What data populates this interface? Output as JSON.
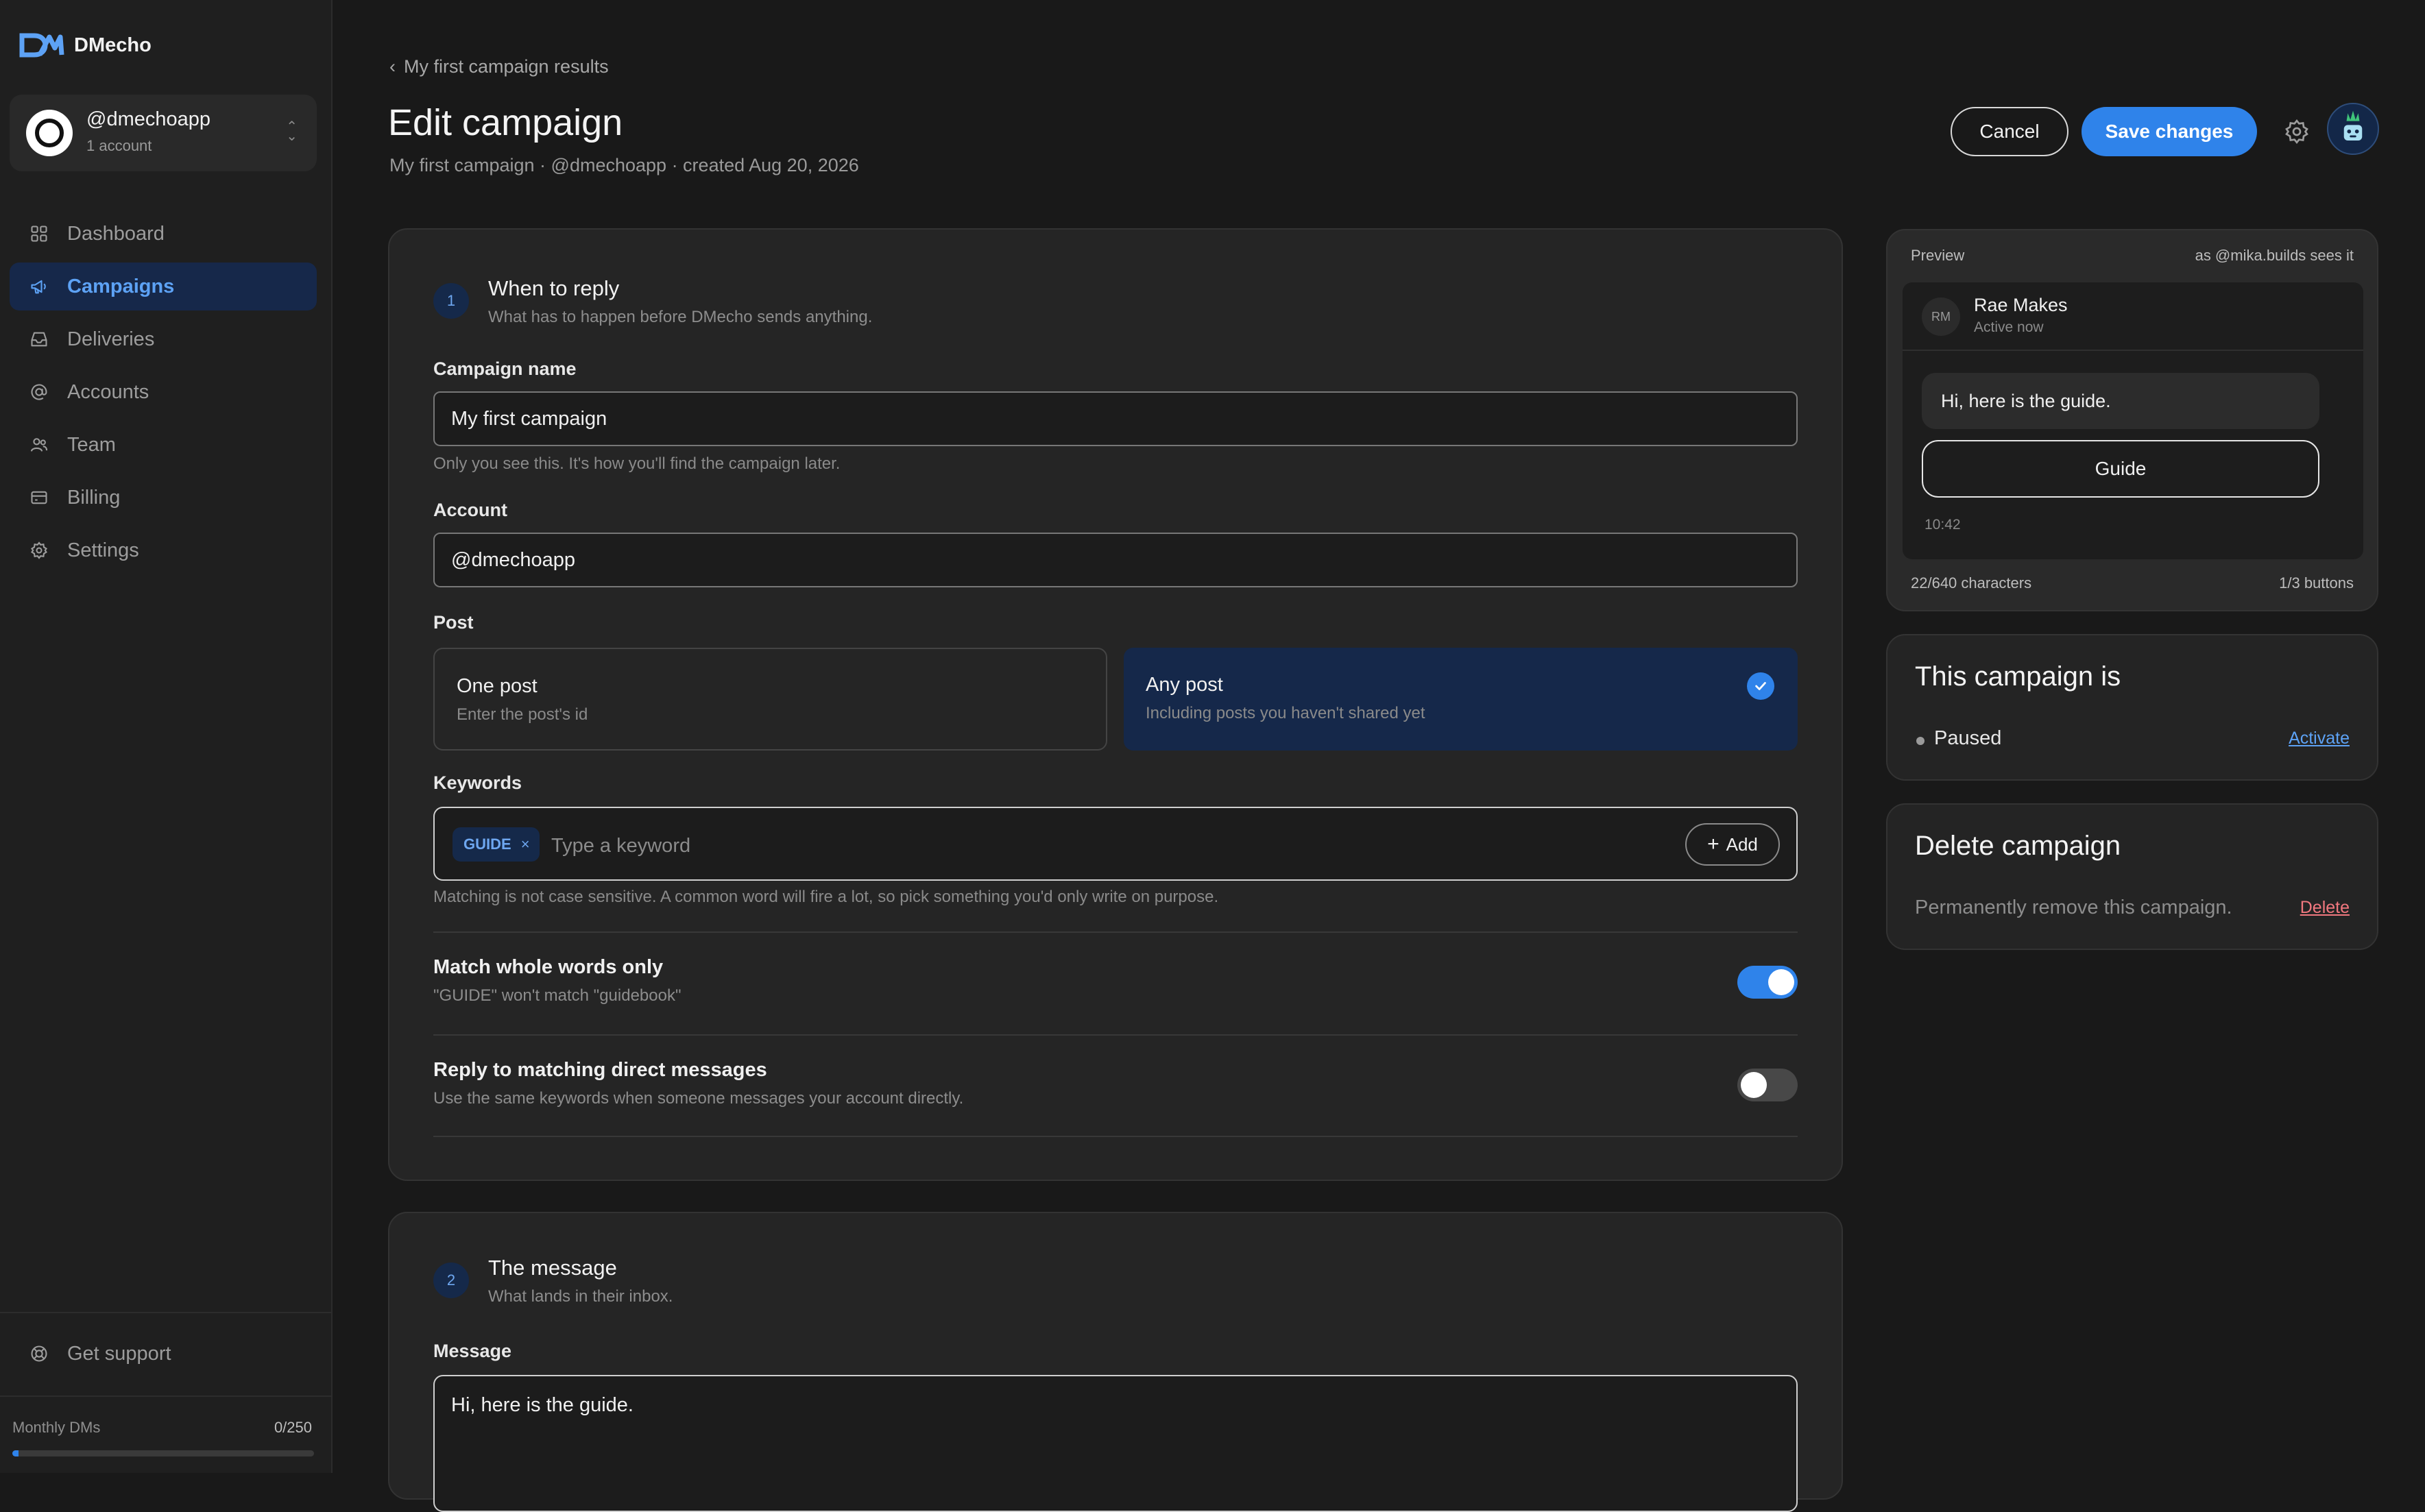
{
  "brand": {
    "name": "DMecho"
  },
  "account_switcher": {
    "handle": "@dmechoapp",
    "count": "1 account"
  },
  "nav": {
    "items": [
      {
        "label": "Dashboard",
        "icon": "grid-icon"
      },
      {
        "label": "Campaigns",
        "icon": "megaphone-icon",
        "active": true
      },
      {
        "label": "Deliveries",
        "icon": "inbox-icon"
      },
      {
        "label": "Accounts",
        "icon": "at-sign-icon"
      },
      {
        "label": "Team",
        "icon": "users-icon"
      },
      {
        "label": "Billing",
        "icon": "credit-card-icon"
      },
      {
        "label": "Settings",
        "icon": "gear-icon"
      }
    ],
    "support": "Get support"
  },
  "usage": {
    "label": "Monthly DMs",
    "count": "0/250",
    "fraction": 0.02
  },
  "header": {
    "breadcrumb": "My first campaign results",
    "title": "Edit campaign",
    "subtitle": "My first campaign · @dmechoapp · created Aug 20, 2026",
    "cancel": "Cancel",
    "save": "Save changes"
  },
  "step1": {
    "number": "1",
    "title": "When to reply",
    "subtitle": "What has to happen before DMecho sends anything.",
    "campaign_name_label": "Campaign name",
    "campaign_name_value": "My first campaign",
    "campaign_name_help": "Only you see this. It's how you'll find the campaign later.",
    "account_label": "Account",
    "account_value": "@dmechoapp",
    "post_label": "Post",
    "post_options": [
      {
        "title": "One post",
        "subtitle": "Enter the post's id"
      },
      {
        "title": "Any post",
        "subtitle": "Including posts you haven't shared yet",
        "selected": true
      }
    ],
    "keywords_label": "Keywords",
    "keyword_chip": "GUIDE",
    "keyword_placeholder": "Type a keyword",
    "keyword_add": "Add",
    "keywords_help": "Matching is not case sensitive. A common word will fire a lot, so pick something you'd only write on purpose.",
    "toggle_whole_title": "Match whole words only",
    "toggle_whole_sub": "\"GUIDE\" won't match \"guidebook\"",
    "toggle_whole_on": true,
    "toggle_dm_title": "Reply to matching direct messages",
    "toggle_dm_sub": "Use the same keywords when someone messages your account directly.",
    "toggle_dm_on": false
  },
  "step2": {
    "number": "2",
    "title": "The message",
    "subtitle": "What lands in their inbox.",
    "message_label": "Message",
    "message_value": "Hi, here is the guide."
  },
  "preview": {
    "label": "Preview",
    "as": "as @mika.builds sees it",
    "contact_initials": "RM",
    "contact_name": "Rae Makes",
    "contact_status": "Active now",
    "bubble": "Hi, here is the guide.",
    "button": "Guide",
    "time": "10:42",
    "chars": "22/640 characters",
    "buttons": "1/3 buttons"
  },
  "status_card": {
    "title": "This campaign is",
    "status": "Paused",
    "action": "Activate"
  },
  "delete_card": {
    "title": "Delete campaign",
    "desc": "Permanently remove this campaign.",
    "action": "Delete"
  },
  "colors": {
    "accent": "#2f83ea",
    "active_nav_bg": "#16284a",
    "danger": "#f2787f",
    "background": "#191919"
  }
}
